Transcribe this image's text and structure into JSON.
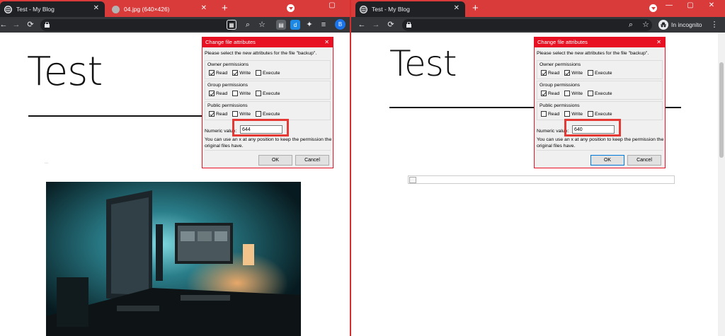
{
  "left_window": {
    "tabs": [
      {
        "title": "Test - My Blog",
        "active": true
      },
      {
        "title": "04.jpg (640×426)",
        "active": false
      }
    ],
    "new_tab": "+",
    "profile_initial": "B",
    "extension_badge": "d",
    "page_title": "Test",
    "caption_text": "..."
  },
  "right_window": {
    "tabs": [
      {
        "title": "Test - My Blog",
        "active": true
      }
    ],
    "new_tab": "+",
    "incognito_label": "In incognito",
    "page_title": "Test"
  },
  "dialog_left": {
    "title": "Change file attributes",
    "description": "Please select the new attributes for the file \"backup\".",
    "groups": [
      {
        "label": "Owner permissions",
        "read": true,
        "write": true,
        "execute": false
      },
      {
        "label": "Group permissions",
        "read": true,
        "write": false,
        "execute": false
      },
      {
        "label": "Public permissions",
        "read": true,
        "write": false,
        "execute": false
      }
    ],
    "checkbox_labels": {
      "read": "Read",
      "write": "Write",
      "execute": "Execute"
    },
    "numeric_label": "Numeric value:",
    "numeric_value": "644",
    "help_text": "You can use an x at any position to keep the permission the original files have.",
    "ok_label": "OK",
    "cancel_label": "Cancel"
  },
  "dialog_right": {
    "title": "Change file attributes",
    "description": "Please select the new attributes for the file \"backup\".",
    "groups": [
      {
        "label": "Owner permissions",
        "read": true,
        "write": true,
        "execute": false
      },
      {
        "label": "Group permissions",
        "read": true,
        "write": false,
        "execute": false
      },
      {
        "label": "Public permissions",
        "read": false,
        "write": false,
        "execute": false
      }
    ],
    "checkbox_labels": {
      "read": "Read",
      "write": "Write",
      "execute": "Execute"
    },
    "numeric_label": "Numeric value:",
    "numeric_value": "640",
    "help_text": "You can use an x at any position to keep the permission the original files have.",
    "ok_label": "OK",
    "cancel_label": "Cancel"
  },
  "colors": {
    "titlebar": "#d93a3a",
    "toolbar": "#35363a",
    "dialog_accent": "#e81123",
    "highlight": "#e53935"
  }
}
